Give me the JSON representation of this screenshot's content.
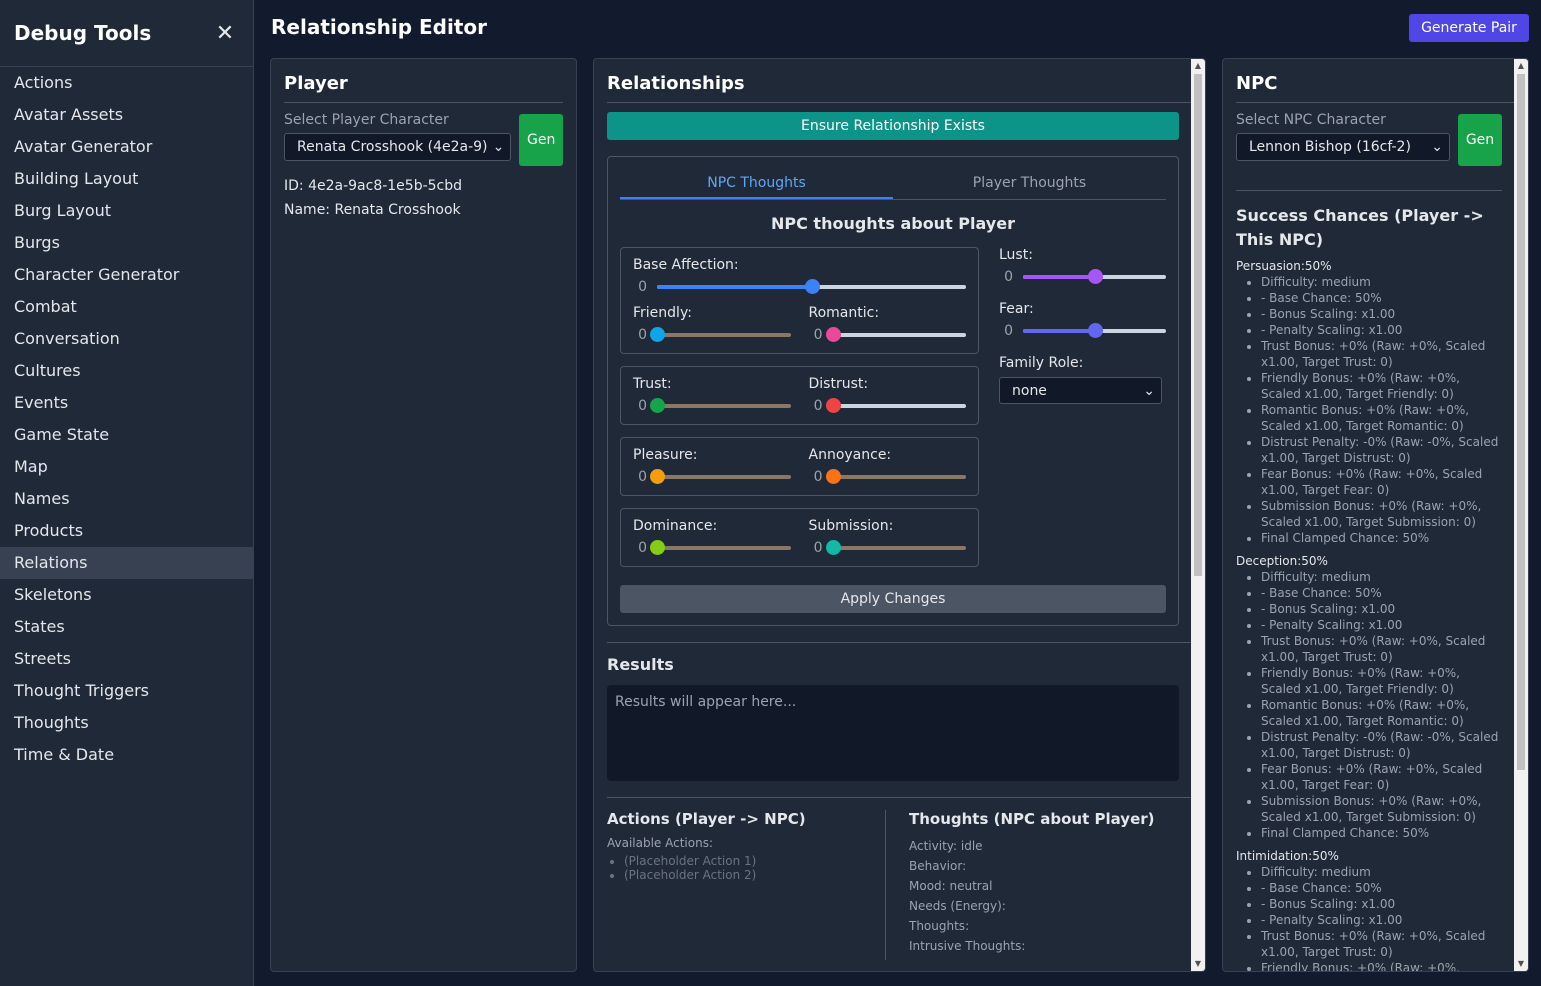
{
  "sidebar": {
    "title": "Debug Tools",
    "close_icon": "close-icon",
    "items": [
      "Actions",
      "Avatar Assets",
      "Avatar Generator",
      "Building Layout",
      "Burg Layout",
      "Burgs",
      "Character Generator",
      "Combat",
      "Conversation",
      "Cultures",
      "Events",
      "Game State",
      "Map",
      "Names",
      "Products",
      "Relations",
      "Skeletons",
      "States",
      "Streets",
      "Thought Triggers",
      "Thoughts",
      "Time & Date"
    ],
    "active_item": "Relations"
  },
  "header": {
    "title": "Relationship Editor",
    "generate_pair_label": "Generate Pair"
  },
  "player": {
    "title": "Player",
    "select_label": "Select Player Character",
    "selected": "Renata Crosshook (4e2a-9)",
    "gen_label": "Gen",
    "id_line": "ID: 4e2a-9ac8-1e5b-5cbd",
    "name_line": "Name: Renata Crosshook"
  },
  "relationships": {
    "title": "Relationships",
    "ensure_label": "Ensure Relationship Exists",
    "tabs": [
      "NPC Thoughts",
      "Player Thoughts"
    ],
    "active_tab": "NPC Thoughts",
    "thoughts_title": "NPC thoughts about Player",
    "sliders": {
      "base_affection": {
        "label": "Base Affection:",
        "value": "0",
        "level": 0.5
      },
      "friendly": {
        "label": "Friendly:",
        "value": "0",
        "level": 0
      },
      "romantic": {
        "label": "Romantic:",
        "value": "0",
        "level": 0
      },
      "trust": {
        "label": "Trust:",
        "value": "0",
        "level": 0
      },
      "distrust": {
        "label": "Distrust:",
        "value": "0",
        "level": 0
      },
      "pleasure": {
        "label": "Pleasure:",
        "value": "0",
        "level": 0
      },
      "annoyance": {
        "label": "Annoyance:",
        "value": "0",
        "level": 0
      },
      "dominance": {
        "label": "Dominance:",
        "value": "0",
        "level": 0
      },
      "submission": {
        "label": "Submission:",
        "value": "0",
        "level": 0
      },
      "lust": {
        "label": "Lust:",
        "value": "0",
        "level": 0.5
      },
      "fear": {
        "label": "Fear:",
        "value": "0",
        "level": 0.5
      }
    },
    "family_role_label": "Family Role:",
    "family_role_value": "none",
    "apply_label": "Apply Changes",
    "results_title": "Results",
    "results_placeholder": "Results will appear here...",
    "actions_title": "Actions (Player -> NPC)",
    "available_actions_label": "Available Actions:",
    "actions": [
      "(Placeholder Action 1)",
      "(Placeholder Action 2)"
    ],
    "thoughts_col_title": "Thoughts (NPC about Player)",
    "thought_lines": [
      "Activity: idle",
      "Behavior:",
      "Mood: neutral",
      "Needs (Energy):",
      "Thoughts:",
      "Intrusive Thoughts:"
    ]
  },
  "npc": {
    "title": "NPC",
    "select_label": "Select NPC Character",
    "selected": "Lennon Bishop (16cf-2)",
    "gen_label": "Gen",
    "success_title": "Success Chances (Player -> This NPC)",
    "sections": [
      {
        "title": "Persuasion:50%",
        "items": [
          "Difficulty: medium",
          "- Base Chance: 50%",
          "- Bonus Scaling: x1.00",
          "- Penalty Scaling: x1.00",
          "Trust Bonus: +0% (Raw: +0%, Scaled x1.00, Target Trust: 0)",
          "Friendly Bonus: +0% (Raw: +0%, Scaled x1.00, Target Friendly: 0)",
          "Romantic Bonus: +0% (Raw: +0%, Scaled x1.00, Target Romantic: 0)",
          "Distrust Penalty: -0% (Raw: -0%, Scaled x1.00, Target Distrust: 0)",
          "Fear Bonus: +0% (Raw: +0%, Scaled x1.00, Target Fear: 0)",
          "Submission Bonus: +0% (Raw: +0%, Scaled x1.00, Target Submission: 0)",
          "Final Clamped Chance: 50%"
        ]
      },
      {
        "title": "Deception:50%",
        "items": [
          "Difficulty: medium",
          "- Base Chance: 50%",
          "- Bonus Scaling: x1.00",
          "- Penalty Scaling: x1.00",
          "Trust Bonus: +0% (Raw: +0%, Scaled x1.00, Target Trust: 0)",
          "Friendly Bonus: +0% (Raw: +0%, Scaled x1.00, Target Friendly: 0)",
          "Romantic Bonus: +0% (Raw: +0%, Scaled x1.00, Target Romantic: 0)",
          "Distrust Penalty: -0% (Raw: -0%, Scaled x1.00, Target Distrust: 0)",
          "Fear Bonus: +0% (Raw: +0%, Scaled x1.00, Target Fear: 0)",
          "Submission Bonus: +0% (Raw: +0%, Scaled x1.00, Target Submission: 0)",
          "Final Clamped Chance: 50%"
        ]
      },
      {
        "title": "Intimidation:50%",
        "items": [
          "Difficulty: medium",
          "- Base Chance: 50%",
          "- Bonus Scaling: x1.00",
          "- Penalty Scaling: x1.00",
          "Trust Bonus: +0% (Raw: +0%, Scaled x1.00, Target Trust: 0)",
          "Friendly Bonus: +0% (Raw: +0%,"
        ]
      }
    ]
  },
  "colors": {
    "sidebar_bg": "#1f2937",
    "page_bg": "#121a2e",
    "accent_blue": "#3b82f6",
    "gen_green": "#16a34a",
    "teal": "#0d9488",
    "indigo": "#4f46e5"
  }
}
